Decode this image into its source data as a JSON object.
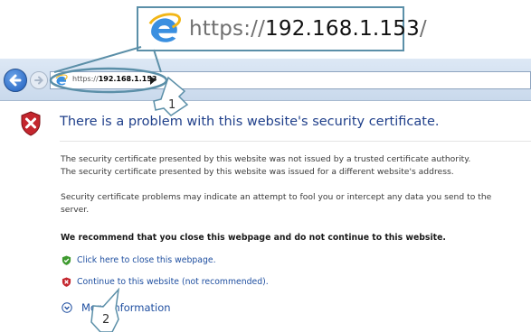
{
  "zoom_callout": {
    "url_prefix": "https://",
    "url_host": "192.168.1.153",
    "url_suffix": "/"
  },
  "address_bar": {
    "url_prefix": "https://",
    "url_host": "192.168.1.153"
  },
  "page": {
    "title": "There is a problem with this website's security certificate.",
    "para1_line1": "The security certificate presented by this website was not issued by a trusted certificate authority.",
    "para1_line2": "The security certificate presented by this website was issued for a different website's address.",
    "para2_line1": "Security certificate problems may indicate an attempt to fool you or intercept any data you send to the",
    "para2_line2": "server.",
    "recommend": "We recommend that you close this webpage and do not continue to this website.",
    "close_link": "Click here to close this webpage.",
    "continue_link": "Continue to this website (not recommended).",
    "more_info": "More information"
  },
  "annotations": {
    "step1": "1",
    "step2": "2"
  },
  "colors": {
    "callout_border": "#5b8fa8",
    "link": "#1f4fa0",
    "title": "#1f3f8a"
  }
}
